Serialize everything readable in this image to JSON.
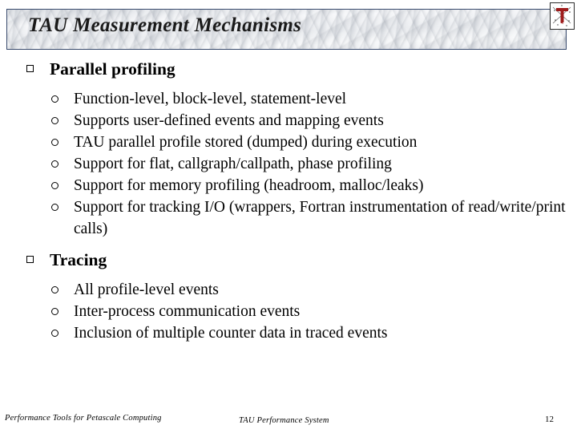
{
  "slide": {
    "title": "TAU Measurement Mechanisms",
    "logo_icon": "tau-logo-icon",
    "bullet_level1_icon": "hollow-square-bullet-icon",
    "bullet_level2_icon": "hollow-circle-bullet-icon",
    "sections": [
      {
        "heading": "Parallel profiling",
        "items": [
          "Function-level, block-level, statement-level",
          "Supports user-defined events and mapping events",
          "TAU parallel profile stored (dumped) during execution",
          "Support for flat, callgraph/callpath, phase profiling",
          "Support for memory profiling (headroom, malloc/leaks)",
          "Support for tracking I/O (wrappers, Fortran instrumentation of read/write/print calls)"
        ]
      },
      {
        "heading": "Tracing",
        "items": [
          "All profile-level events",
          "Inter-process communication events",
          "Inclusion of multiple counter data in traced events"
        ]
      }
    ]
  },
  "footer": {
    "left": "Performance Tools for Petascale Computing",
    "center": "TAU Performance System",
    "page_number": "12"
  },
  "colors": {
    "banner_border": "#36486b",
    "text": "#000000",
    "logo_red": "#9e1b1b",
    "background": "#ffffff"
  }
}
